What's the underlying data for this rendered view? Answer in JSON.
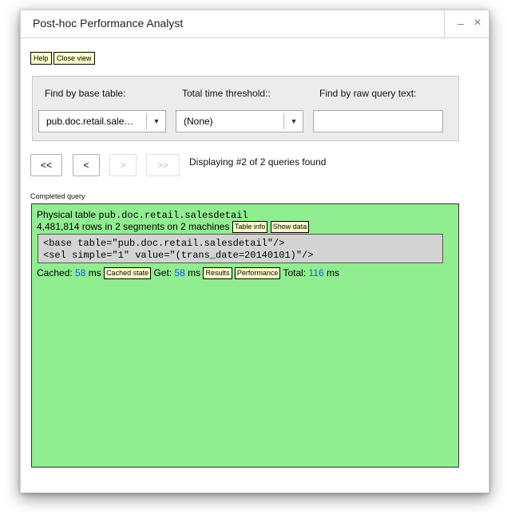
{
  "window": {
    "title": "Post-hoc Performance Analyst",
    "minimize": "–",
    "close": "×"
  },
  "toolbar": {
    "help_label": "Help",
    "close_view_label": "Close view"
  },
  "filters": {
    "base_table": {
      "label": "Find by base table:",
      "value": "pub.doc.retail.sale…"
    },
    "time_threshold": {
      "label": "Total time threshold::",
      "value": "(None)"
    },
    "raw_query": {
      "label": "Find by raw query text:",
      "value": ""
    }
  },
  "navigation": {
    "first": "<<",
    "prev": "<",
    "next": ">",
    "last": ">>",
    "status": "Displaying #2 of 2 queries found"
  },
  "query": {
    "section_label": "Completed query",
    "physical_table_prefix": "Physical table ",
    "table_name": "pub.doc.retail.salesdetail",
    "rows_text": "4,481,814 rows in 2 segments on 2 machines",
    "table_info_label": "Table info",
    "show_data_label": "Show data",
    "xml_line1": "<base table=\"pub.doc.retail.salesdetail\"/>",
    "xml_line2": "<sel simple=\"1\" value=\"(trans_date=20140101)\"/>",
    "cached_prefix": "Cached: ",
    "cached_ms": "58",
    "ms_unit": " ms ",
    "cached_state_label": "Cached state",
    "get_prefix": " Get: ",
    "get_ms": "58",
    "results_label": "Results",
    "performance_label": "Performance",
    "total_prefix": " Total: ",
    "total_ms": "116",
    "ms_unit_end": " ms"
  },
  "colors": {
    "query_panel_bg": "#90ee90",
    "button_bg": "#ffffcc",
    "value_blue": "#1a56e8"
  }
}
